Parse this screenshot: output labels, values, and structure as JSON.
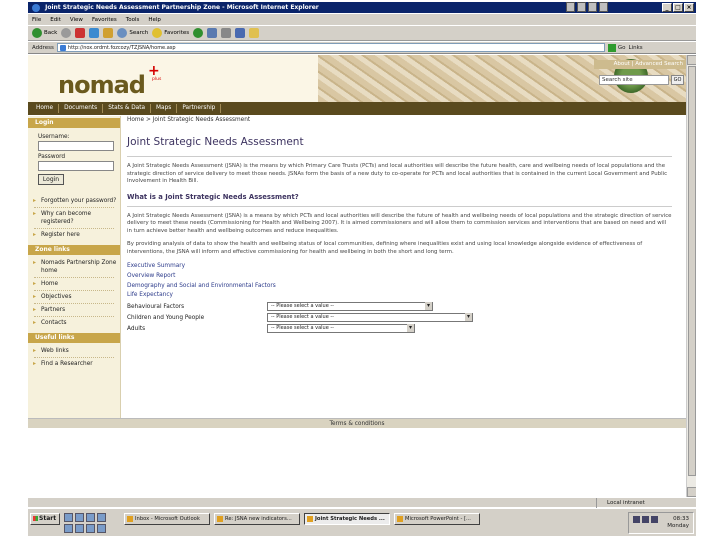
{
  "browser": {
    "title": "Joint Strategic Needs Assessment Partnership Zone - Microsoft Internet Explorer",
    "menu": [
      "File",
      "Edit",
      "View",
      "Favorites",
      "Tools",
      "Help"
    ],
    "toolbar": {
      "back": "Back",
      "search": "Search",
      "favorites": "Favorites"
    },
    "address_label": "Address",
    "address": "http://nox.ordmt.fozcozy/TZJSNA/home.asp",
    "go": "Go",
    "links": "Links",
    "status_zone": "Local intranet"
  },
  "site": {
    "logo": "nomad",
    "logo_plus": "+",
    "logo_sub": "plus",
    "header_links": "About | Advanced Search",
    "search_placeholder": "Search site",
    "search_go": "GO",
    "nav": [
      "Home",
      "Documents",
      "Stats & Data",
      "Maps",
      "Partnership"
    ]
  },
  "sidebar": {
    "login_heading": "Login",
    "username_label": "Username:",
    "password_label": "Password",
    "login_button": "Login",
    "login_links": [
      "Forgotten your password?",
      "Why can become registered?",
      "Register here"
    ],
    "zone_heading": "Zone links",
    "zone_links": [
      "Nomads Partnership Zone home",
      "Home",
      "Objectives",
      "Partners",
      "Contacts"
    ],
    "useful_heading": "Useful links",
    "useful_links": [
      "Web links",
      "Find a Researcher"
    ]
  },
  "main": {
    "breadcrumb": "Home > Joint Strategic Needs Assessment",
    "title": "Joint Strategic Needs Assessment",
    "intro": "A Joint Strategic Needs Assessment (JSNA) is the means by which Primary Care Trusts (PCTs) and local authorities will describe the future health, care and wellbeing needs of local populations and the strategic direction of service delivery to meet those needs. JSNAs form the basis of a new duty to co-operate for PCTs and local authorities that is contained in the current Local Government and Public Involvement in Health Bill.",
    "subheading": "What is a Joint Strategic Needs Assessment?",
    "para1": "A Joint Strategic Needs Assessment (JSNA) is a means by which PCTs and local authorities will describe the future of health and wellbeing needs of local populations and the strategic direction of service delivery to meet these needs (Commissioning for Health and Wellbeing 2007). It is aimed commissioners and will allow them to commission services and interventions that are based on need and will in turn achieve better health and wellbeing outcomes and reduce inequalities.",
    "para2": "By providing analysis of data to show the health and wellbeing status of local communities, defining where inequalities exist and using local knowledge alongside evidence of effectiveness of interventions, the JSNA will inform and effective commissioning for health and wellbeing in both the short and long term.",
    "links": [
      "Executive Summary",
      "Overview Report",
      "Demography and Social and Environmental Factors",
      "Life Expectancy"
    ],
    "filters": [
      {
        "label": "Behavioural Factors",
        "value": "-- Please select a value --"
      },
      {
        "label": "Children and Young People",
        "value": "-- Please select a value --"
      },
      {
        "label": "Adults",
        "value": "-- Please select a value --"
      }
    ]
  },
  "footer": "Terms & conditions",
  "taskbar": {
    "start": "Start",
    "tasks": [
      "Inbox - Microsoft Outlook",
      "Re: JSNA new indicators...",
      "Joint Strategic Needs ...",
      "Microsoft PowerPoint - [..."
    ],
    "time": "08:33",
    "day": "Monday"
  }
}
